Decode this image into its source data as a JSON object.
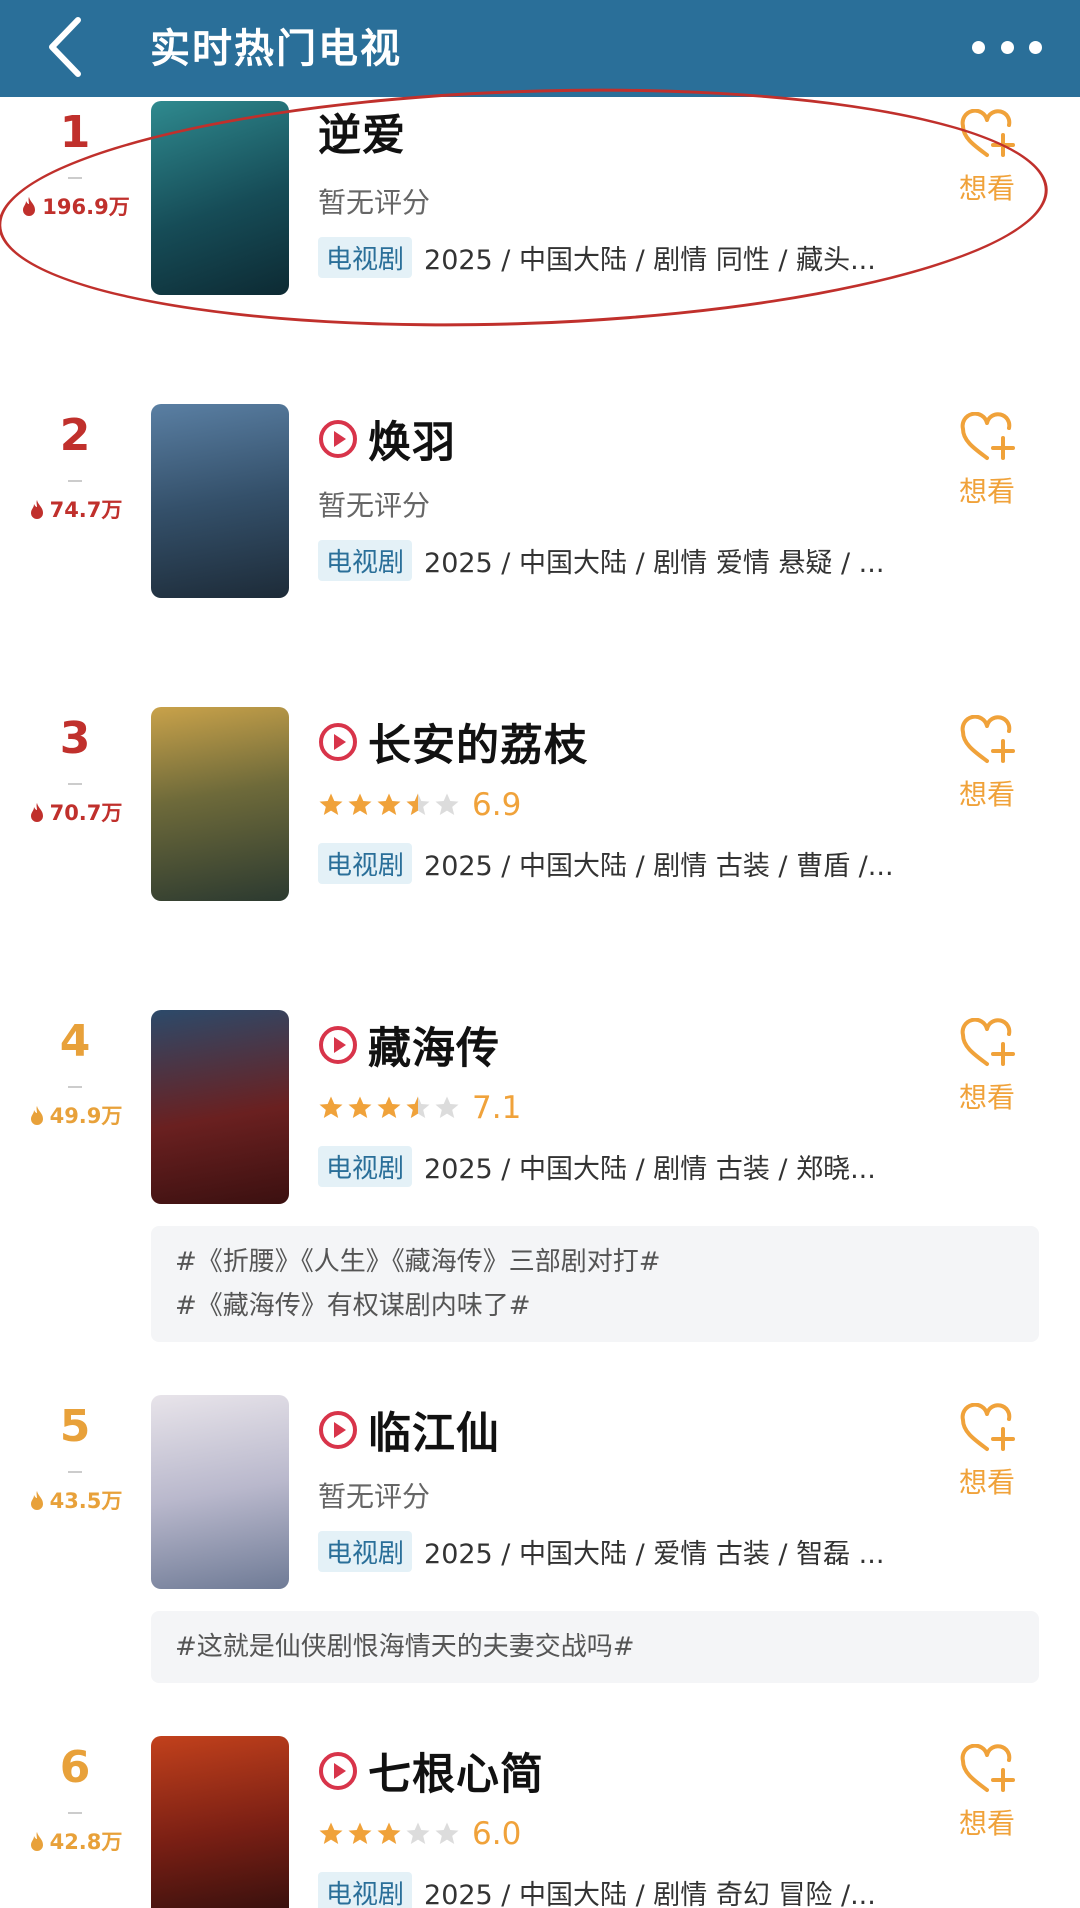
{
  "header": {
    "title": "实时热门电视",
    "back_icon": "chevron-left-icon",
    "more_icon": "more-dots-icon",
    "bg_color": "#2a6f99"
  },
  "colors": {
    "rank_top": "#c0302c",
    "rank_other": "#e8a13a",
    "accent": "#f0a23a",
    "tag_bg": "#e4f1f7",
    "tag_text": "#2a6f99"
  },
  "want_label": "想看",
  "items": [
    {
      "rank": "1",
      "heat": "196.9万",
      "title": "逆爱",
      "has_play": false,
      "rating_text": "暂无评分",
      "stars": null,
      "score": "",
      "tag": "电视剧",
      "meta": "2025 / 中国大陆 / 剧情 同性 / 藏头...",
      "topics": []
    },
    {
      "rank": "2",
      "heat": "74.7万",
      "title": "焕羽",
      "has_play": true,
      "rating_text": "暂无评分",
      "stars": null,
      "score": "",
      "tag": "电视剧",
      "meta": "2025 / 中国大陆 / 剧情 爱情 悬疑 / ...",
      "topics": []
    },
    {
      "rank": "3",
      "heat": "70.7万",
      "title": "长安的荔枝",
      "has_play": true,
      "rating_text": "",
      "stars": 3.5,
      "score": "6.9",
      "tag": "电视剧",
      "meta": "2025 / 中国大陆 / 剧情 古装 / 曹盾 /...",
      "topics": []
    },
    {
      "rank": "4",
      "heat": "49.9万",
      "title": "藏海传",
      "has_play": true,
      "rating_text": "",
      "stars": 3.5,
      "score": "7.1",
      "tag": "电视剧",
      "meta": "2025 / 中国大陆 / 剧情 古装 / 郑晓...",
      "topics": [
        "#《折腰》《人生》《藏海传》三部剧对打#",
        "#《藏海传》有权谋剧内味了#"
      ]
    },
    {
      "rank": "5",
      "heat": "43.5万",
      "title": "临江仙",
      "has_play": true,
      "rating_text": "暂无评分",
      "stars": null,
      "score": "",
      "tag": "电视剧",
      "meta": "2025 / 中国大陆 / 爱情 古装 / 智磊 ...",
      "topics": [
        "#这就是仙侠剧恨海情天的夫妻交战吗#"
      ]
    },
    {
      "rank": "6",
      "heat": "42.8万",
      "title": "七根心简",
      "has_play": true,
      "rating_text": "",
      "stars": 3,
      "score": "6.0",
      "tag": "电视剧",
      "meta": "2025 / 中国大陆 / 剧情 奇幻 冒险 /...",
      "topics": []
    }
  ]
}
